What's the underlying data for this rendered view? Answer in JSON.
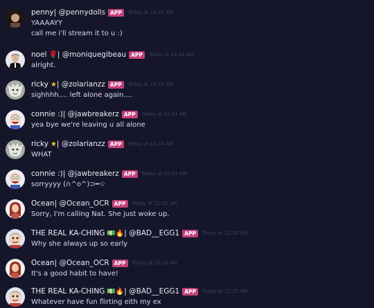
{
  "colors": {
    "background": "#16162b",
    "badge": "#c2417a",
    "name_text": "#f0f1f7",
    "body_text": "#d9dbe6",
    "timestamp_text": "#3c4062"
  },
  "messages": [
    {
      "avatar_icon": "user-avatar-penny",
      "display_name": "penny",
      "name_emoji": "",
      "handle": " | @pennydolls",
      "badge": "APP",
      "timestamp": "Today at 12:22 AM",
      "text": "YAAAAYY",
      "text2": "call me i'll stream it to u :)"
    },
    {
      "avatar_icon": "user-avatar-noel",
      "display_name": "noel",
      "name_emoji": "🌹",
      "handle": " | @moniquegibeau",
      "badge": "APP",
      "timestamp": "Today at 12:22 AM",
      "text": "alright."
    },
    {
      "avatar_icon": "user-avatar-ricky",
      "display_name": "ricky",
      "name_emoji": "★",
      "handle": " | @zolarianzz",
      "badge": "APP",
      "timestamp": "Today at 12:23 AM",
      "text": "sighhhh.... left alone again...."
    },
    {
      "avatar_icon": "user-avatar-connie",
      "display_name": "connie :)",
      "name_emoji": "",
      "handle": " | @jawbreakerz",
      "badge": "APP",
      "timestamp": "Today at 12:24 AM",
      "text": "yea bye we're leaving u all alone"
    },
    {
      "avatar_icon": "user-avatar-ricky",
      "display_name": "ricky",
      "name_emoji": "★",
      "handle": " | @zolarianzz",
      "badge": "APP",
      "timestamp": "Today at 12:24 AM",
      "text": "WHAT"
    },
    {
      "avatar_icon": "user-avatar-connie",
      "display_name": "connie :)",
      "name_emoji": "",
      "handle": " | @jawbreakerz",
      "badge": "APP",
      "timestamp": "Today at 12:24 AM",
      "text": "sorryyyy (∩^o^)⊃━☆"
    },
    {
      "avatar_icon": "user-avatar-ocean",
      "display_name": "Ocean",
      "name_emoji": "",
      "handle": " | @Ocean_OCR",
      "badge": "APP",
      "timestamp": "Today at 12:25 AM",
      "text": "Sorry, I'm calling Nat. She just woke up."
    },
    {
      "avatar_icon": "user-avatar-kaching",
      "display_name": "THE REAL KA-CHING",
      "name_emoji": "💵🔥",
      "handle": " | @BAD__EGG1",
      "badge": "APP",
      "timestamp": "Today at 12:25 AM",
      "text": "Why she always up so early"
    },
    {
      "avatar_icon": "user-avatar-ocean",
      "display_name": "Ocean",
      "name_emoji": "",
      "handle": " | @Ocean_OCR",
      "badge": "APP",
      "timestamp": "Today at 12:25 AM",
      "text": "It's a good habit to have!"
    },
    {
      "avatar_icon": "user-avatar-kaching",
      "display_name": "THE REAL KA-CHING",
      "name_emoji": "💵🔥",
      "handle": " | @BAD__EGG1",
      "badge": "APP",
      "timestamp": "Today at 12:25 AM",
      "text": "Whatever have fun flirting eith my ex"
    }
  ]
}
